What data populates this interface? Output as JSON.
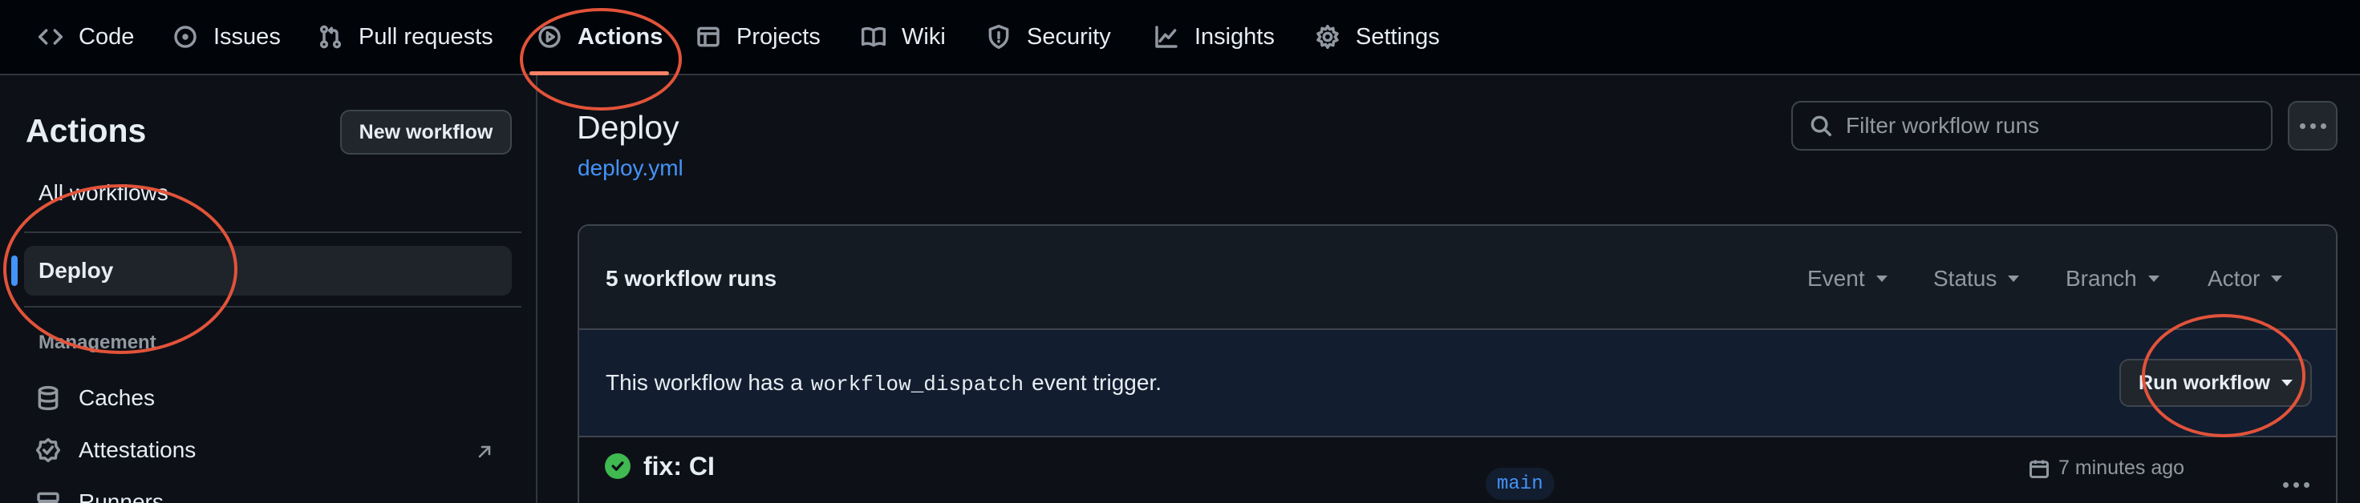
{
  "nav": {
    "tabs": [
      {
        "label": "Code",
        "icon": "code-icon"
      },
      {
        "label": "Issues",
        "icon": "issue-icon"
      },
      {
        "label": "Pull requests",
        "icon": "pull-request-icon"
      },
      {
        "label": "Actions",
        "icon": "play-icon",
        "active": true
      },
      {
        "label": "Projects",
        "icon": "table-icon"
      },
      {
        "label": "Wiki",
        "icon": "book-icon"
      },
      {
        "label": "Security",
        "icon": "shield-icon"
      },
      {
        "label": "Insights",
        "icon": "graph-icon"
      },
      {
        "label": "Settings",
        "icon": "gear-icon"
      }
    ]
  },
  "sidebar": {
    "title": "Actions",
    "new_workflow_label": "New workflow",
    "items": [
      {
        "label": "All workflows"
      },
      {
        "label": "Deploy",
        "active": true
      }
    ],
    "management_heading": "Management",
    "management_items": [
      {
        "label": "Caches",
        "icon": "database-icon"
      },
      {
        "label": "Attestations",
        "icon": "verified-icon"
      },
      {
        "label": "Runners",
        "icon": "server-icon"
      }
    ]
  },
  "main": {
    "title": "Deploy",
    "file_link": "deploy.yml",
    "filter_placeholder": "Filter workflow runs",
    "run_count": "5 workflow runs",
    "filters": [
      "Event",
      "Status",
      "Branch",
      "Actor"
    ],
    "dispatch": {
      "prefix": "This workflow has a",
      "code": "workflow_dispatch",
      "suffix": "event trigger."
    },
    "run_workflow_label": "Run workflow",
    "runs": [
      {
        "title": "fix: CI",
        "branch": "main",
        "time": "7 minutes ago",
        "status": "success"
      }
    ]
  },
  "colors": {
    "accent_blue": "#4493f8",
    "tab_underline": "#f78166",
    "success_green": "#3fb950",
    "annotation_red": "#e2533a"
  }
}
